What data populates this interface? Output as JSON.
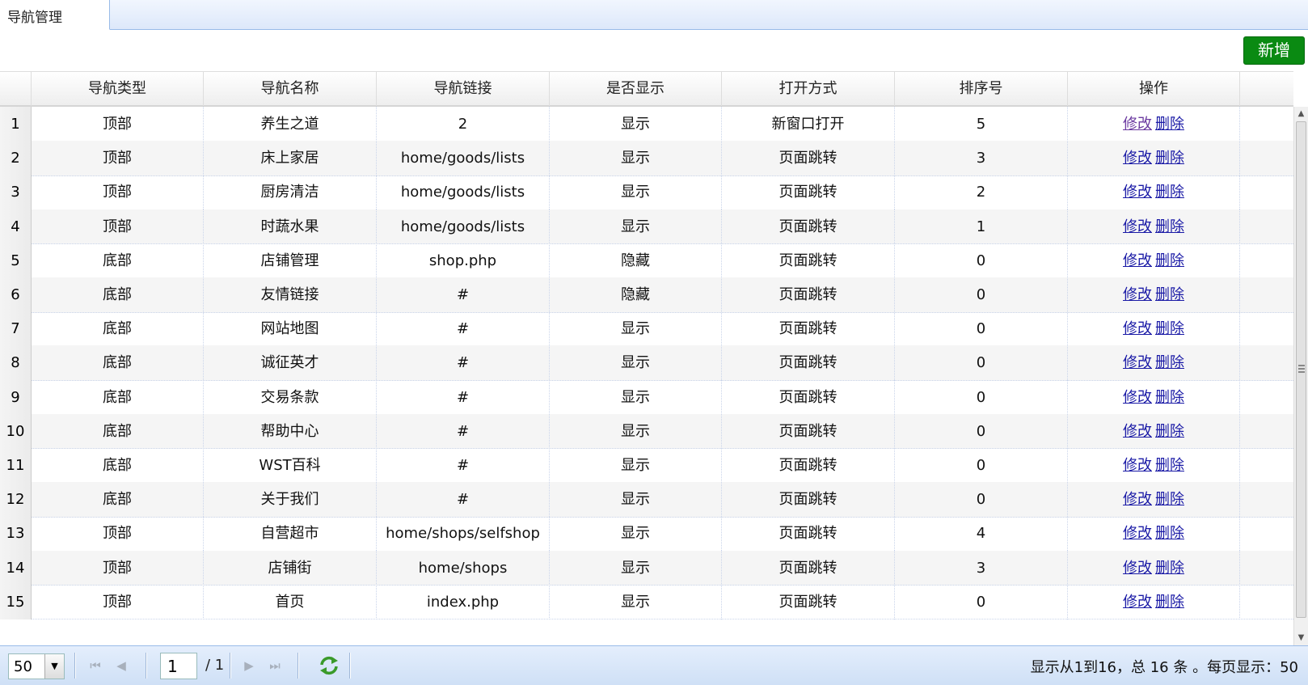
{
  "tab": {
    "title": "导航管理"
  },
  "toolbar": {
    "add_label": "新增"
  },
  "columns": [
    "导航类型",
    "导航名称",
    "导航链接",
    "是否显示",
    "打开方式",
    "排序号",
    "操作"
  ],
  "rows": [
    {
      "num": "1",
      "type": "顶部",
      "name": "养生之道",
      "link": "2",
      "show": "显示",
      "open": "新窗口打开",
      "order": "5"
    },
    {
      "num": "2",
      "type": "顶部",
      "name": "床上家居",
      "link": "home/goods/lists",
      "show": "显示",
      "open": "页面跳转",
      "order": "3"
    },
    {
      "num": "3",
      "type": "顶部",
      "name": "厨房清洁",
      "link": "home/goods/lists",
      "show": "显示",
      "open": "页面跳转",
      "order": "2"
    },
    {
      "num": "4",
      "type": "顶部",
      "name": "时蔬水果",
      "link": "home/goods/lists",
      "show": "显示",
      "open": "页面跳转",
      "order": "1"
    },
    {
      "num": "5",
      "type": "底部",
      "name": "店铺管理",
      "link": "shop.php",
      "show": "隐藏",
      "open": "页面跳转",
      "order": "0"
    },
    {
      "num": "6",
      "type": "底部",
      "name": "友情链接",
      "link": "#",
      "show": "隐藏",
      "open": "页面跳转",
      "order": "0"
    },
    {
      "num": "7",
      "type": "底部",
      "name": "网站地图",
      "link": "#",
      "show": "显示",
      "open": "页面跳转",
      "order": "0"
    },
    {
      "num": "8",
      "type": "底部",
      "name": "诚征英才",
      "link": "#",
      "show": "显示",
      "open": "页面跳转",
      "order": "0"
    },
    {
      "num": "9",
      "type": "底部",
      "name": "交易条款",
      "link": "#",
      "show": "显示",
      "open": "页面跳转",
      "order": "0"
    },
    {
      "num": "10",
      "type": "底部",
      "name": "帮助中心",
      "link": "#",
      "show": "显示",
      "open": "页面跳转",
      "order": "0"
    },
    {
      "num": "11",
      "type": "底部",
      "name": "WST百科",
      "link": "#",
      "show": "显示",
      "open": "页面跳转",
      "order": "0"
    },
    {
      "num": "12",
      "type": "底部",
      "name": "关于我们",
      "link": "#",
      "show": "显示",
      "open": "页面跳转",
      "order": "0"
    },
    {
      "num": "13",
      "type": "顶部",
      "name": "自营超市",
      "link": "home/shops/selfshop",
      "show": "显示",
      "open": "页面跳转",
      "order": "4"
    },
    {
      "num": "14",
      "type": "顶部",
      "name": "店铺街",
      "link": "home/shops",
      "show": "显示",
      "open": "页面跳转",
      "order": "3"
    },
    {
      "num": "15",
      "type": "顶部",
      "name": "首页",
      "link": "index.php",
      "show": "显示",
      "open": "页面跳转",
      "order": "0"
    }
  ],
  "actions": {
    "edit": "修改",
    "delete": "删除"
  },
  "pager": {
    "page_size": "50",
    "current_page": "1",
    "total_pages": "/ 1",
    "summary": "显示从1到16，总 16 条 。每页显示：50",
    "icons": [
      "first-page-icon",
      "prev-page-icon",
      "next-page-icon",
      "last-page-icon",
      "refresh-icon"
    ]
  },
  "colors": {
    "add_button": "#0a8a12",
    "link": "#1a1aa6",
    "visited_link": "#6b3aa0",
    "pager_bg": "#d8e6f8"
  }
}
